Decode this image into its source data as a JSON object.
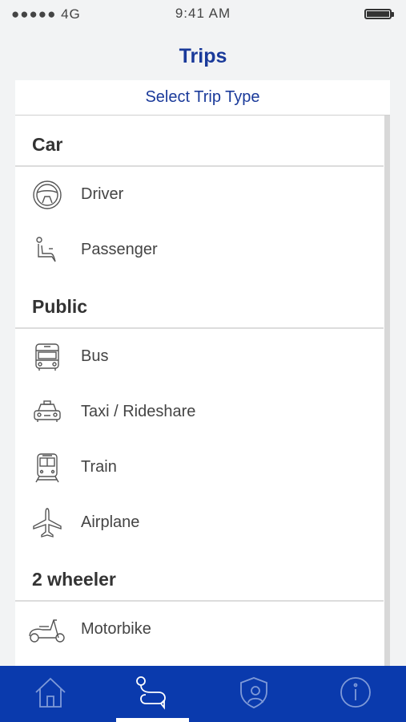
{
  "status_bar": {
    "signal": "●●●●● 4G",
    "time": "9:41 AM"
  },
  "header": {
    "title": "Trips"
  },
  "panel": {
    "subtitle": "Select Trip Type"
  },
  "sections": [
    {
      "title": "Car",
      "items": [
        {
          "label": "Driver",
          "icon": "steering-wheel-icon"
        },
        {
          "label": "Passenger",
          "icon": "car-seat-icon"
        }
      ]
    },
    {
      "title": "Public",
      "items": [
        {
          "label": "Bus",
          "icon": "bus-icon"
        },
        {
          "label": "Taxi / Rideshare",
          "icon": "taxi-icon"
        },
        {
          "label": "Train",
          "icon": "train-icon"
        },
        {
          "label": "Airplane",
          "icon": "airplane-icon"
        }
      ]
    },
    {
      "title": "2 wheeler",
      "items": [
        {
          "label": "Motorbike",
          "icon": "scooter-icon"
        }
      ]
    }
  ],
  "tab_bar": {
    "tabs": [
      {
        "icon": "home-icon",
        "active": false
      },
      {
        "icon": "route-icon",
        "active": true
      },
      {
        "icon": "shield-user-icon",
        "active": false
      },
      {
        "icon": "info-icon",
        "active": false
      }
    ]
  },
  "colors": {
    "accent": "#1a3a9a",
    "tab_bar": "#0a3aad",
    "background": "#f2f3f4"
  }
}
